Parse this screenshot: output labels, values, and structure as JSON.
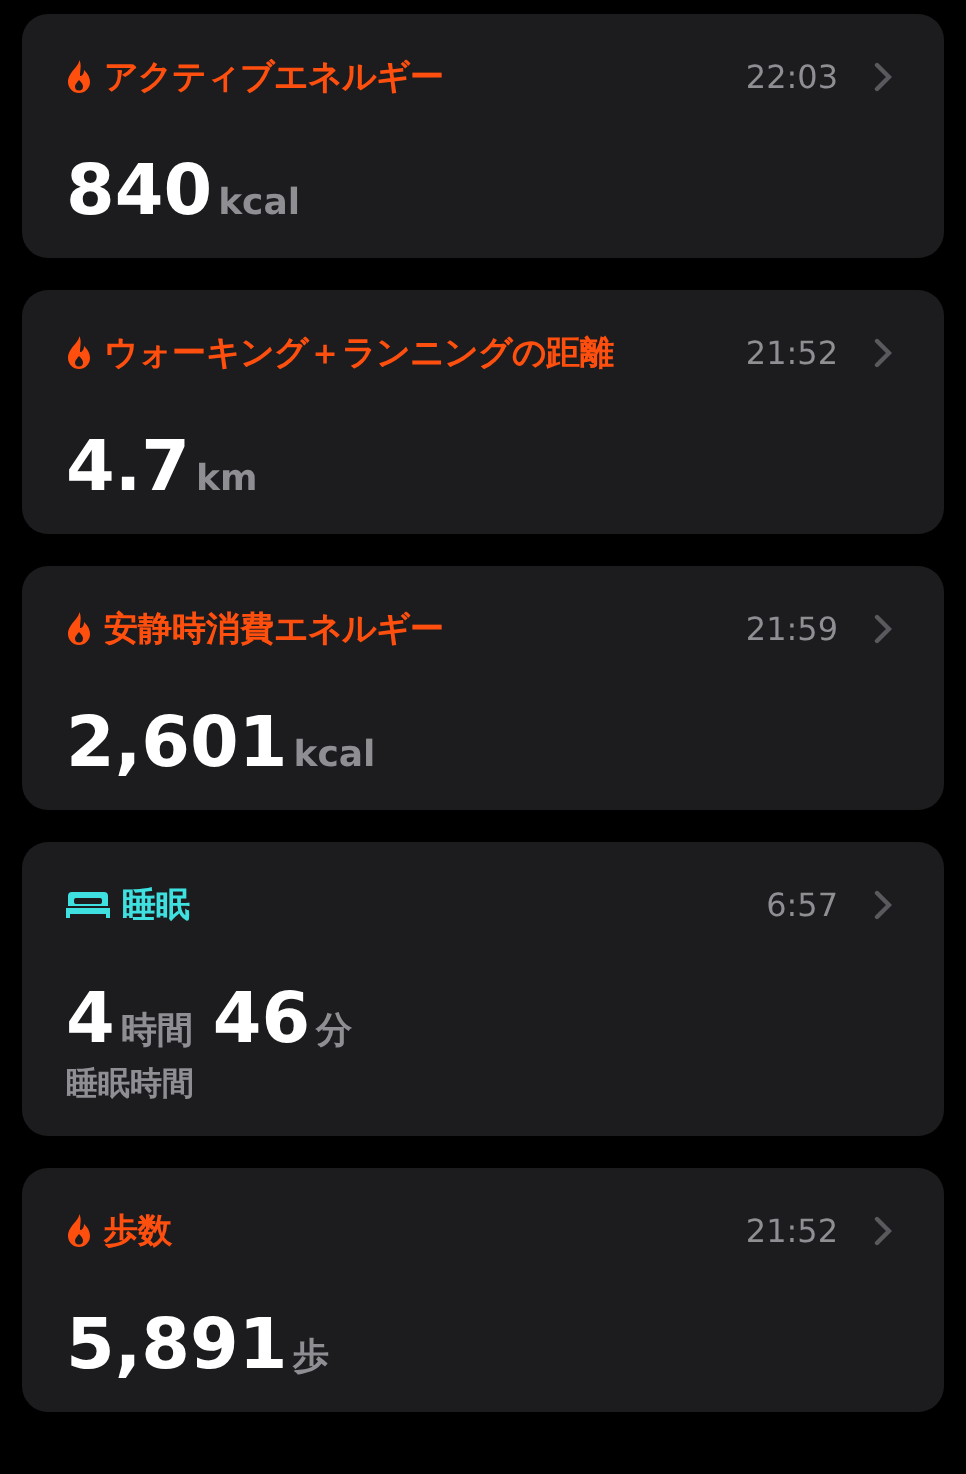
{
  "cards": [
    {
      "kind": "flame",
      "color": "#ff4f0f",
      "title": "アクティブエネルギー",
      "time": "22:03",
      "value": [
        {
          "number": "840",
          "unit": "kcal"
        }
      ]
    },
    {
      "kind": "flame",
      "color": "#ff4f0f",
      "title": "ウォーキング＋ランニングの距離",
      "time": "21:52",
      "value": [
        {
          "number": "4.7",
          "unit": "km"
        }
      ]
    },
    {
      "kind": "flame",
      "color": "#ff4f0f",
      "title": "安静時消費エネルギー",
      "time": "21:59",
      "value": [
        {
          "number": "2,601",
          "unit": "kcal"
        }
      ]
    },
    {
      "kind": "bed",
      "color": "#3ee0e0",
      "title": "睡眠",
      "time": "6:57",
      "value": [
        {
          "number": "4",
          "unit": "時間"
        },
        {
          "number": "46",
          "unit": "分"
        }
      ],
      "caption": "睡眠時間"
    },
    {
      "kind": "flame",
      "color": "#ff4f0f",
      "title": "歩数",
      "time": "21:52",
      "value": [
        {
          "number": "5,891",
          "unit": "歩"
        }
      ]
    }
  ]
}
